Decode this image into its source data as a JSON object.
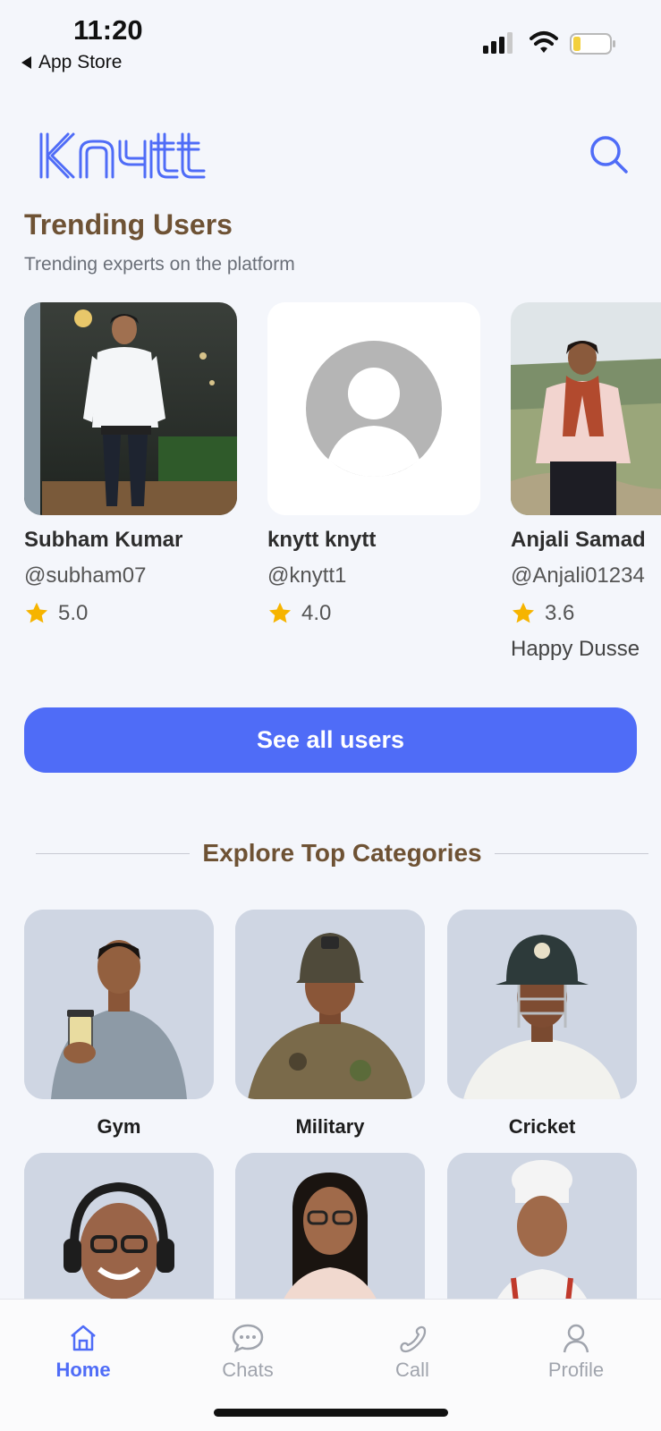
{
  "status_bar": {
    "time": "11:20",
    "back_app": "App Store"
  },
  "header": {
    "logo_text": "knytt",
    "brand_color": "#4f6cf7",
    "search_icon": "search-icon"
  },
  "trending": {
    "title": "Trending Users",
    "subtitle": "Trending experts on the platform",
    "users": [
      {
        "name": "Subham Kumar",
        "handle": "@subham07",
        "rating": "5.0",
        "bio": ""
      },
      {
        "name": "knytt knytt",
        "handle": "@knytt1",
        "rating": "4.0",
        "bio": ""
      },
      {
        "name": "Anjali Samad",
        "handle": "@Anjali01234",
        "rating": "3.6",
        "bio": "Happy Dusse"
      }
    ],
    "see_all_label": "See all users"
  },
  "categories": {
    "title": "Explore Top Categories",
    "items": [
      {
        "label": "Gym"
      },
      {
        "label": "Military"
      },
      {
        "label": "Cricket"
      },
      {
        "label": ""
      },
      {
        "label": ""
      },
      {
        "label": ""
      }
    ]
  },
  "tab_bar": {
    "tabs": [
      {
        "label": "Home",
        "icon": "home-icon",
        "active": true
      },
      {
        "label": "Chats",
        "icon": "chat-icon",
        "active": false
      },
      {
        "label": "Call",
        "icon": "phone-icon",
        "active": false
      },
      {
        "label": "Profile",
        "icon": "profile-icon",
        "active": false
      }
    ]
  }
}
